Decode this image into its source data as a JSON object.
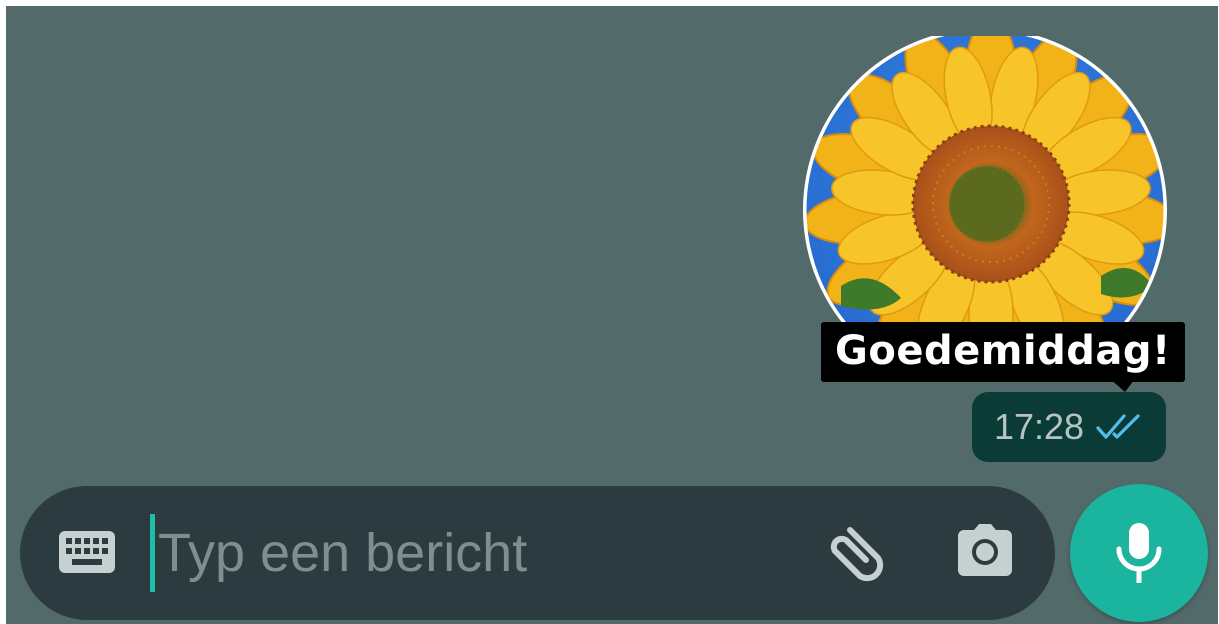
{
  "sticker": {
    "caption": "Goedemiddag!"
  },
  "message": {
    "time": "17:28",
    "status_icon": "double-check-read-icon",
    "status_color": "#53bdeb"
  },
  "composer": {
    "placeholder": "Typ een bericht",
    "value": "",
    "icons": [
      "keyboard-icon",
      "paperclip-icon",
      "camera-icon",
      "microphone-icon"
    ]
  },
  "colors": {
    "chat_background": "#536a6a",
    "composer_background": "#2b3b3f",
    "accent": "#1ab49f",
    "bubble_outgoing": "#0b3b36"
  }
}
